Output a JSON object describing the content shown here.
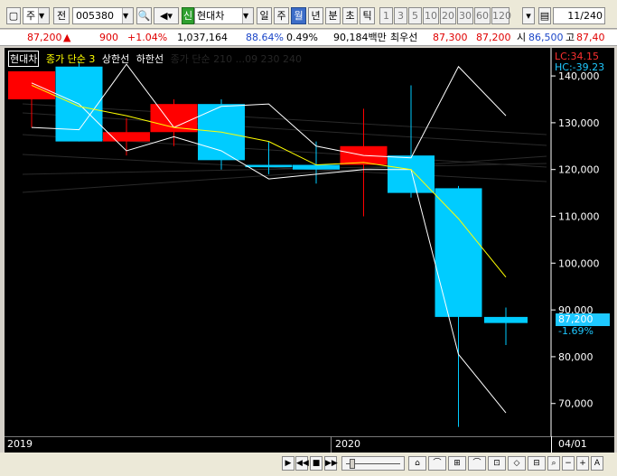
{
  "toolbar": {
    "period_type": "주",
    "prev_label": "전",
    "code": "005380",
    "badge": "신",
    "stock_name": "현대차",
    "periods": [
      "일",
      "주",
      "월",
      "년",
      "분",
      "초",
      "틱"
    ],
    "selected_period": "월",
    "intervals": [
      "1",
      "3",
      "5",
      "10",
      "20",
      "30",
      "60",
      "120"
    ],
    "page": "11",
    "page_total": "/240"
  },
  "quote": {
    "price": "87,200",
    "arrow": "▲",
    "change": "900",
    "change_pct": "+1.04%",
    "volume": "1,037,164",
    "volume_ratio": "88.64%",
    "turnover": "0.49%",
    "amount": "90,184백만",
    "best_label": "최우선",
    "ask": "87,300",
    "bid": "87,200",
    "open_label": "시",
    "open": "86,500",
    "high_label": "고",
    "high": "87,40"
  },
  "legend": {
    "name": "현대차",
    "ma": "종가 단순 3",
    "upper": "상한선",
    "lower": "하한선",
    "faded": "종가 단순 210 ...09 230 240"
  },
  "readout": {
    "lc": "LC:34.15",
    "hc": "HC:-39.23"
  },
  "price_box": {
    "price": "87,200",
    "pct": "-1.69%"
  },
  "x_labels": [
    "2019",
    "2020",
    "04/01"
  ],
  "colors": {
    "up": "#ff0000",
    "down": "#00ccff",
    "ma": "#ffff00",
    "band": "#ffffff",
    "axis": "#ffffff"
  },
  "chart_data": {
    "type": "candlestick",
    "y_ticks": [
      70000,
      80000,
      90000,
      100000,
      110000,
      120000,
      130000,
      140000
    ],
    "ylim": [
      63000,
      146000
    ],
    "candles": [
      {
        "o": 135000,
        "h": 141000,
        "l": 129000,
        "c": 141000
      },
      {
        "o": 142000,
        "h": 143000,
        "l": 126000,
        "c": 126000
      },
      {
        "o": 126000,
        "h": 131000,
        "l": 123000,
        "c": 128000
      },
      {
        "o": 128000,
        "h": 135000,
        "l": 125000,
        "c": 134000
      },
      {
        "o": 134000,
        "h": 135000,
        "l": 120000,
        "c": 122000
      },
      {
        "o": 121000,
        "h": 126000,
        "l": 119000,
        "c": 120500
      },
      {
        "o": 121000,
        "h": 126000,
        "l": 117000,
        "c": 120000
      },
      {
        "o": 121000,
        "h": 133000,
        "l": 110000,
        "c": 125000
      },
      {
        "o": 123000,
        "h": 138000,
        "l": 114000,
        "c": 115000
      },
      {
        "o": 116000,
        "h": 116500,
        "l": 65000,
        "c": 88500
      },
      {
        "o": 88500,
        "h": 90500,
        "l": 82500,
        "c": 87200
      }
    ],
    "ma3": [
      138000,
      133500,
      131500,
      129000,
      128000,
      126000,
      121000,
      121500,
      120000,
      109500,
      97000
    ],
    "upper_band": [
      129000,
      128500,
      142500,
      129000,
      133500,
      134000,
      125000,
      123000,
      122500,
      142000,
      131500
    ],
    "lower_band": [
      138500,
      134000,
      124000,
      127000,
      124000,
      118000,
      119000,
      120000,
      120000,
      80500,
      68000
    ]
  }
}
